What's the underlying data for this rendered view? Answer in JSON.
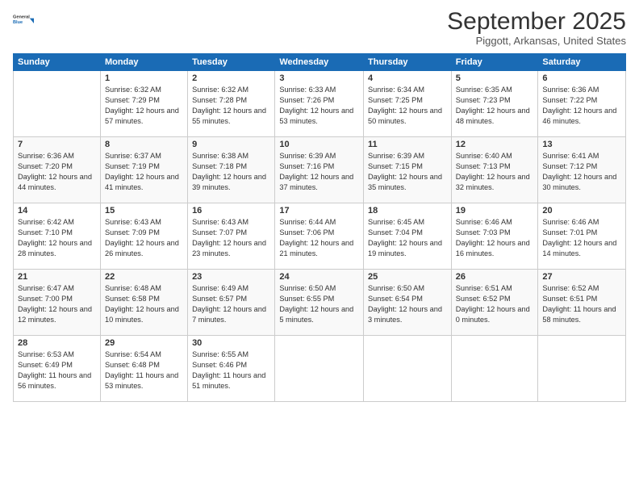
{
  "header": {
    "logo_line1": "General",
    "logo_line2": "Blue",
    "month": "September 2025",
    "location": "Piggott, Arkansas, United States"
  },
  "days_of_week": [
    "Sunday",
    "Monday",
    "Tuesday",
    "Wednesday",
    "Thursday",
    "Friday",
    "Saturday"
  ],
  "weeks": [
    [
      {
        "day": "",
        "sunrise": "",
        "sunset": "",
        "daylight": ""
      },
      {
        "day": "1",
        "sunrise": "Sunrise: 6:32 AM",
        "sunset": "Sunset: 7:29 PM",
        "daylight": "Daylight: 12 hours and 57 minutes."
      },
      {
        "day": "2",
        "sunrise": "Sunrise: 6:32 AM",
        "sunset": "Sunset: 7:28 PM",
        "daylight": "Daylight: 12 hours and 55 minutes."
      },
      {
        "day": "3",
        "sunrise": "Sunrise: 6:33 AM",
        "sunset": "Sunset: 7:26 PM",
        "daylight": "Daylight: 12 hours and 53 minutes."
      },
      {
        "day": "4",
        "sunrise": "Sunrise: 6:34 AM",
        "sunset": "Sunset: 7:25 PM",
        "daylight": "Daylight: 12 hours and 50 minutes."
      },
      {
        "day": "5",
        "sunrise": "Sunrise: 6:35 AM",
        "sunset": "Sunset: 7:23 PM",
        "daylight": "Daylight: 12 hours and 48 minutes."
      },
      {
        "day": "6",
        "sunrise": "Sunrise: 6:36 AM",
        "sunset": "Sunset: 7:22 PM",
        "daylight": "Daylight: 12 hours and 46 minutes."
      }
    ],
    [
      {
        "day": "7",
        "sunrise": "Sunrise: 6:36 AM",
        "sunset": "Sunset: 7:20 PM",
        "daylight": "Daylight: 12 hours and 44 minutes."
      },
      {
        "day": "8",
        "sunrise": "Sunrise: 6:37 AM",
        "sunset": "Sunset: 7:19 PM",
        "daylight": "Daylight: 12 hours and 41 minutes."
      },
      {
        "day": "9",
        "sunrise": "Sunrise: 6:38 AM",
        "sunset": "Sunset: 7:18 PM",
        "daylight": "Daylight: 12 hours and 39 minutes."
      },
      {
        "day": "10",
        "sunrise": "Sunrise: 6:39 AM",
        "sunset": "Sunset: 7:16 PM",
        "daylight": "Daylight: 12 hours and 37 minutes."
      },
      {
        "day": "11",
        "sunrise": "Sunrise: 6:39 AM",
        "sunset": "Sunset: 7:15 PM",
        "daylight": "Daylight: 12 hours and 35 minutes."
      },
      {
        "day": "12",
        "sunrise": "Sunrise: 6:40 AM",
        "sunset": "Sunset: 7:13 PM",
        "daylight": "Daylight: 12 hours and 32 minutes."
      },
      {
        "day": "13",
        "sunrise": "Sunrise: 6:41 AM",
        "sunset": "Sunset: 7:12 PM",
        "daylight": "Daylight: 12 hours and 30 minutes."
      }
    ],
    [
      {
        "day": "14",
        "sunrise": "Sunrise: 6:42 AM",
        "sunset": "Sunset: 7:10 PM",
        "daylight": "Daylight: 12 hours and 28 minutes."
      },
      {
        "day": "15",
        "sunrise": "Sunrise: 6:43 AM",
        "sunset": "Sunset: 7:09 PM",
        "daylight": "Daylight: 12 hours and 26 minutes."
      },
      {
        "day": "16",
        "sunrise": "Sunrise: 6:43 AM",
        "sunset": "Sunset: 7:07 PM",
        "daylight": "Daylight: 12 hours and 23 minutes."
      },
      {
        "day": "17",
        "sunrise": "Sunrise: 6:44 AM",
        "sunset": "Sunset: 7:06 PM",
        "daylight": "Daylight: 12 hours and 21 minutes."
      },
      {
        "day": "18",
        "sunrise": "Sunrise: 6:45 AM",
        "sunset": "Sunset: 7:04 PM",
        "daylight": "Daylight: 12 hours and 19 minutes."
      },
      {
        "day": "19",
        "sunrise": "Sunrise: 6:46 AM",
        "sunset": "Sunset: 7:03 PM",
        "daylight": "Daylight: 12 hours and 16 minutes."
      },
      {
        "day": "20",
        "sunrise": "Sunrise: 6:46 AM",
        "sunset": "Sunset: 7:01 PM",
        "daylight": "Daylight: 12 hours and 14 minutes."
      }
    ],
    [
      {
        "day": "21",
        "sunrise": "Sunrise: 6:47 AM",
        "sunset": "Sunset: 7:00 PM",
        "daylight": "Daylight: 12 hours and 12 minutes."
      },
      {
        "day": "22",
        "sunrise": "Sunrise: 6:48 AM",
        "sunset": "Sunset: 6:58 PM",
        "daylight": "Daylight: 12 hours and 10 minutes."
      },
      {
        "day": "23",
        "sunrise": "Sunrise: 6:49 AM",
        "sunset": "Sunset: 6:57 PM",
        "daylight": "Daylight: 12 hours and 7 minutes."
      },
      {
        "day": "24",
        "sunrise": "Sunrise: 6:50 AM",
        "sunset": "Sunset: 6:55 PM",
        "daylight": "Daylight: 12 hours and 5 minutes."
      },
      {
        "day": "25",
        "sunrise": "Sunrise: 6:50 AM",
        "sunset": "Sunset: 6:54 PM",
        "daylight": "Daylight: 12 hours and 3 minutes."
      },
      {
        "day": "26",
        "sunrise": "Sunrise: 6:51 AM",
        "sunset": "Sunset: 6:52 PM",
        "daylight": "Daylight: 12 hours and 0 minutes."
      },
      {
        "day": "27",
        "sunrise": "Sunrise: 6:52 AM",
        "sunset": "Sunset: 6:51 PM",
        "daylight": "Daylight: 11 hours and 58 minutes."
      }
    ],
    [
      {
        "day": "28",
        "sunrise": "Sunrise: 6:53 AM",
        "sunset": "Sunset: 6:49 PM",
        "daylight": "Daylight: 11 hours and 56 minutes."
      },
      {
        "day": "29",
        "sunrise": "Sunrise: 6:54 AM",
        "sunset": "Sunset: 6:48 PM",
        "daylight": "Daylight: 11 hours and 53 minutes."
      },
      {
        "day": "30",
        "sunrise": "Sunrise: 6:55 AM",
        "sunset": "Sunset: 6:46 PM",
        "daylight": "Daylight: 11 hours and 51 minutes."
      },
      {
        "day": "",
        "sunrise": "",
        "sunset": "",
        "daylight": ""
      },
      {
        "day": "",
        "sunrise": "",
        "sunset": "",
        "daylight": ""
      },
      {
        "day": "",
        "sunrise": "",
        "sunset": "",
        "daylight": ""
      },
      {
        "day": "",
        "sunrise": "",
        "sunset": "",
        "daylight": ""
      }
    ]
  ]
}
